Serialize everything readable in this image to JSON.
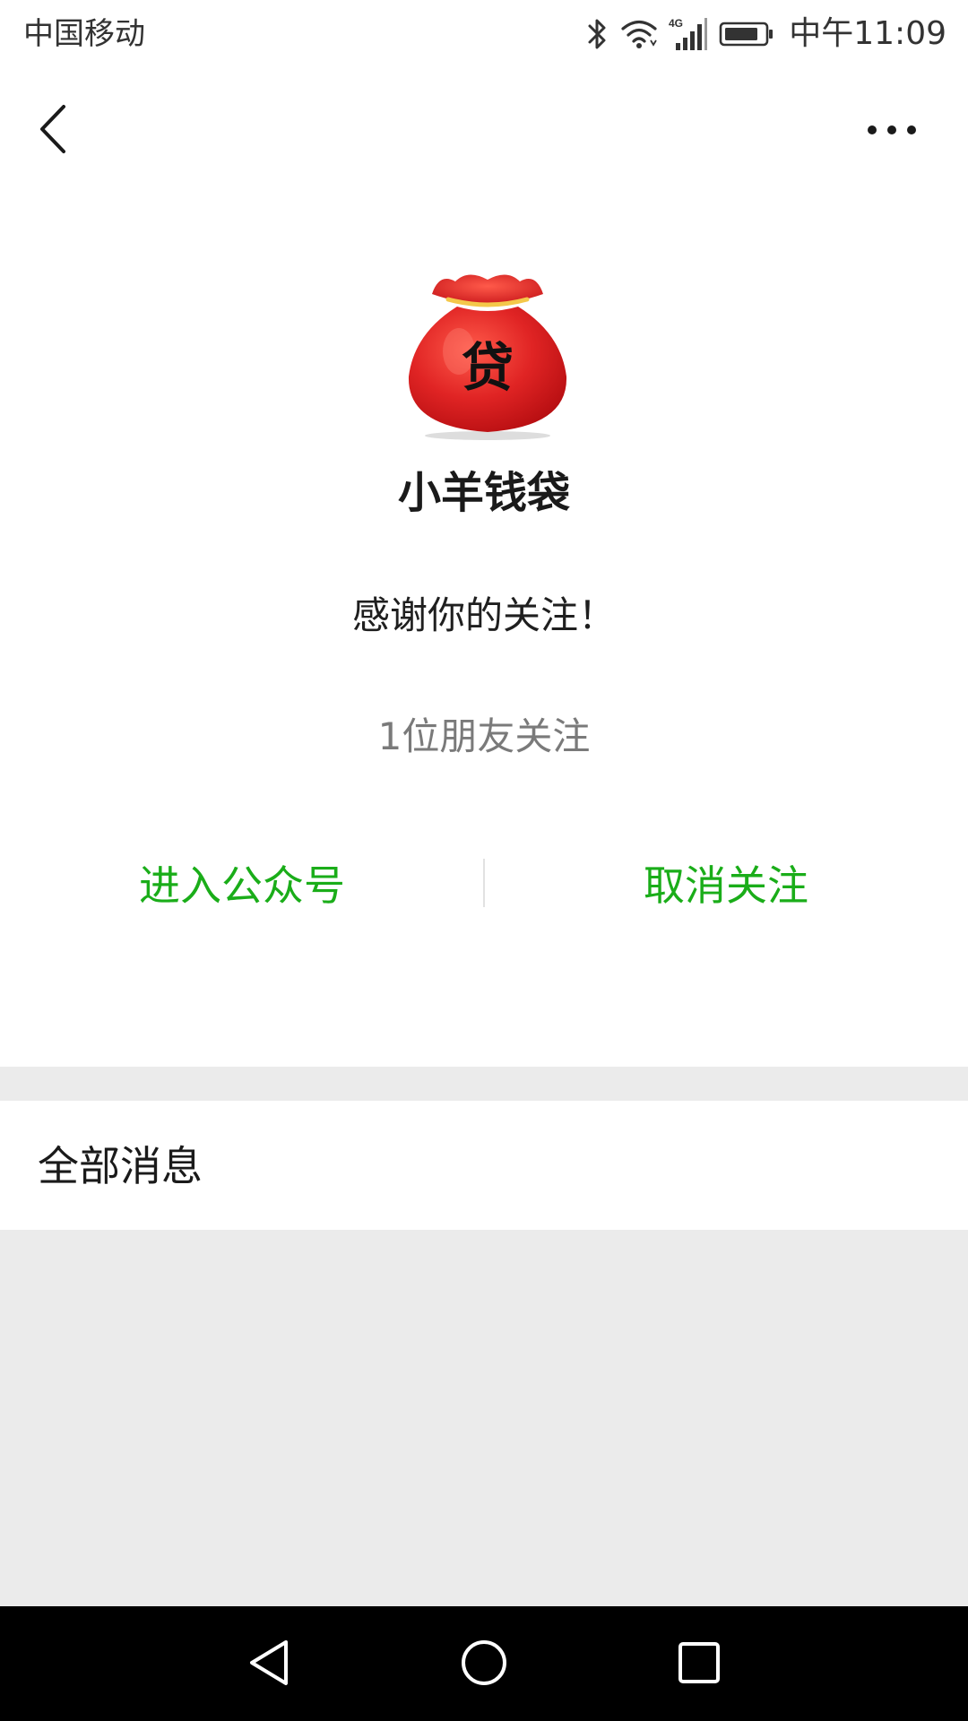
{
  "status_bar": {
    "carrier": "中国移动",
    "network": "4G",
    "time": "中午11:09",
    "icons": [
      "bluetooth-icon",
      "wifi-icon",
      "signal-icon",
      "battery-icon"
    ]
  },
  "nav": {
    "back_icon": "chevron-left-icon",
    "more_icon": "more-horizontal-icon"
  },
  "profile": {
    "avatar_text": "贷",
    "name": "小羊钱袋",
    "welcome": "感谢你的关注！",
    "followers": "1位朋友关注"
  },
  "actions": {
    "enter_label": "进入公众号",
    "unfollow_label": "取消关注"
  },
  "messages": {
    "title": "全部消息"
  },
  "system_nav": {
    "icons": [
      "back-triangle-icon",
      "home-circle-icon",
      "recents-square-icon"
    ]
  },
  "colors": {
    "accent_green": "#1aad19",
    "avatar_red": "#e02424",
    "gray_bg": "#ebebeb"
  }
}
